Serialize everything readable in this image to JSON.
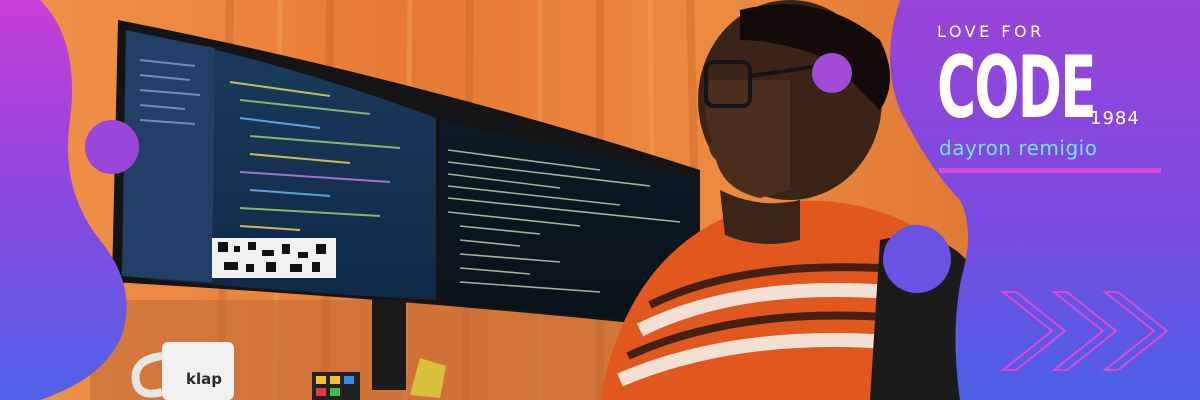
{
  "banner": {
    "kicker": "LOVE FOR",
    "headline": "CODE",
    "year": "1984",
    "author": "dayron remigio"
  },
  "mug": {
    "label": "klap"
  },
  "colors": {
    "accent_cyan": "#6ee7f5",
    "accent_magenta": "#d94ad8",
    "purple": "#7a3fd0",
    "blue": "#4a5fe0",
    "curtain_orange": "#e8833a"
  },
  "icons": [
    "chevron-right-icon",
    "chevron-right-icon",
    "chevron-right-icon"
  ]
}
